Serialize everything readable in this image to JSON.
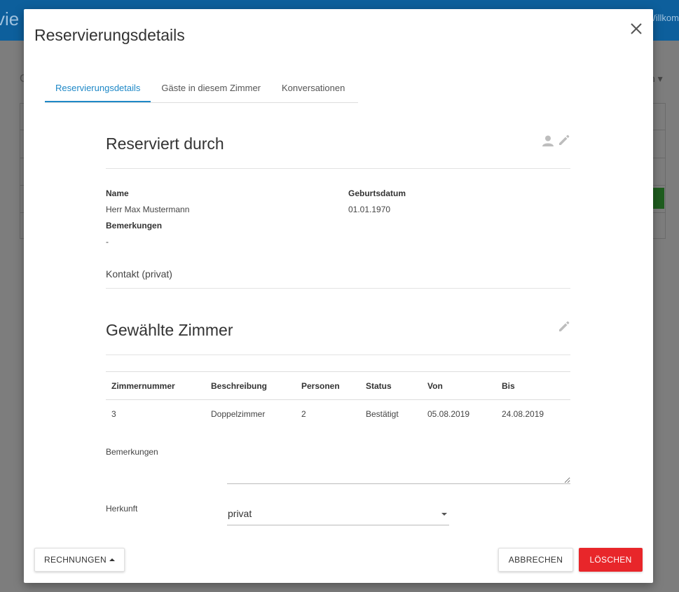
{
  "background": {
    "app_title": "vie",
    "welcome_text": "Willkom",
    "letter": "G",
    "dropdown_text": "n"
  },
  "modal": {
    "title": "Reservierungsdetails",
    "tabs": [
      {
        "label": "Reservierungsdetails",
        "active": true
      },
      {
        "label": "Gäste in diesem Zimmer",
        "active": false
      },
      {
        "label": "Konversationen",
        "active": false
      }
    ],
    "booked_by": {
      "title": "Reserviert durch",
      "name_label": "Name",
      "name_value": "Herr Max Mustermann",
      "birthdate_label": "Geburtsdatum",
      "birthdate_value": "01.01.1970",
      "remarks_label": "Bemerkungen",
      "remarks_value": "-",
      "contact_label": "Kontakt (privat)"
    },
    "rooms": {
      "title": "Gewählte Zimmer",
      "columns": [
        "Zimmernummer",
        "Beschreibung",
        "Personen",
        "Status",
        "Von",
        "Bis"
      ],
      "rows": [
        [
          "3",
          "Doppelzimmer",
          "2",
          "Bestätigt",
          "05.08.2019",
          "24.08.2019"
        ]
      ]
    },
    "form": {
      "remarks_label": "Bemerkungen",
      "remarks_value": "",
      "origin_label": "Herkunft",
      "origin_value": "privat"
    },
    "buttons": {
      "invoices": "RECHNUNGEN",
      "cancel": "ABBRECHEN",
      "delete": "LÖSCHEN"
    }
  },
  "colors": {
    "accent": "#1e88c7",
    "danger": "#e8262a",
    "header": "#0d5f9c"
  },
  "icons": [
    "close-icon",
    "person-icon",
    "pencil-icon",
    "caret-down-icon",
    "caret-up-icon"
  ]
}
